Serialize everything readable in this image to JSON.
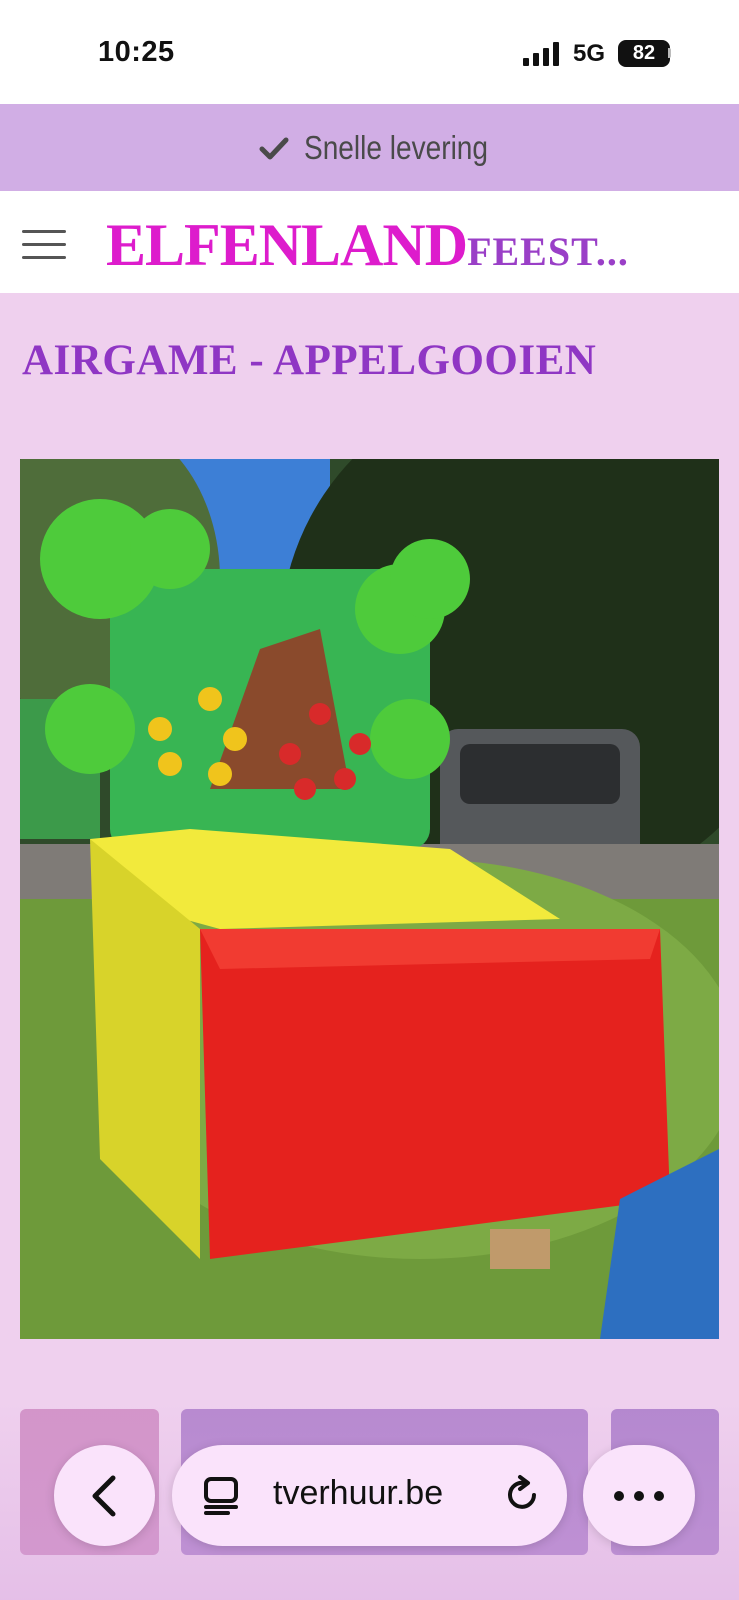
{
  "status_bar": {
    "time": "10:25",
    "network": "5G",
    "battery": "82"
  },
  "promo": {
    "text": "Snelle levering",
    "icon": "check-icon"
  },
  "header": {
    "menu_icon": "hamburger-menu-icon",
    "logo_main": "ELFENLAND",
    "logo_sub": "FEEST..."
  },
  "page": {
    "title": "AIRGAME - APPELGOOIEN"
  },
  "toolbar": {
    "back_icon": "chevron-left-icon",
    "tabs_icon": "tabs-icon",
    "url": "tverhuur.be",
    "reload_icon": "reload-icon",
    "more_icon": "more-dots-icon"
  },
  "colors": {
    "promo_bg": "#d1aee5",
    "logo_main": "#dd1ccc",
    "logo_sub": "#9a3fc7",
    "title": "#8f36c4",
    "page_bg": "#efd0ee"
  }
}
